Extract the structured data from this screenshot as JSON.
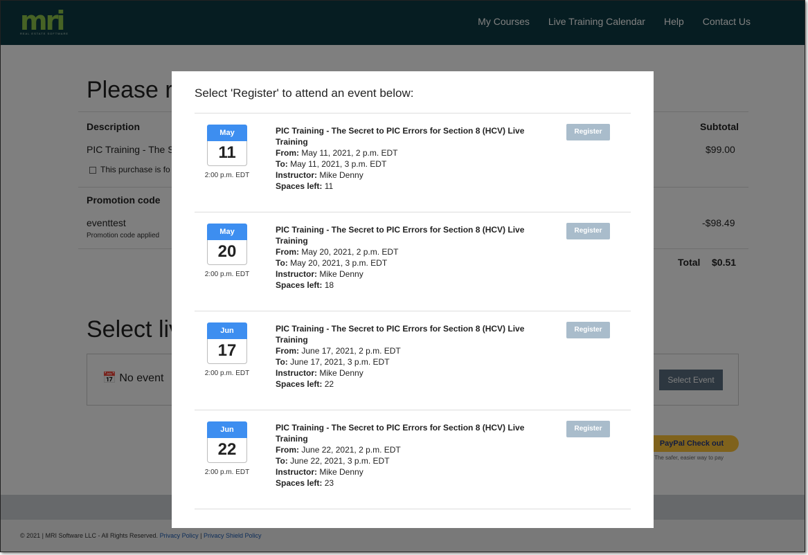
{
  "nav": {
    "logo_text": "mri",
    "logo_subtext": "REAL ESTATE SOFTWARE",
    "links": [
      "My Courses",
      "Live Training Calendar",
      "Help",
      "Contact Us"
    ]
  },
  "background": {
    "heading1": "Please re",
    "description_header": "Description",
    "subtotal_header": "Subtotal",
    "item_name": "PIC Training - The S",
    "item_price": "$99.00",
    "purchase_check_label": "This purchase is fo",
    "promo_header": "Promotion code",
    "promo_code": "eventtest",
    "promo_note": "Promotion code applied",
    "promo_discount": "-$98.49",
    "total_label": "Total",
    "total_value": "$0.51",
    "heading2": "Select liv",
    "no_event_text": "No event",
    "select_event_button": "Select Event",
    "paypal_label": "PayPal Check out",
    "paypal_sub": "The safer, easier way to pay"
  },
  "footer": {
    "copyright": "© 2021 | MRI Software LLC - All Rights Reserved.",
    "privacy_policy": "Privacy Policy",
    "separator": "|",
    "privacy_shield": "Privacy Shield Policy"
  },
  "modal": {
    "title": "Select 'Register' to attend an event below:",
    "register_label": "Register",
    "labels": {
      "from": "From:",
      "to": "To:",
      "instructor": "Instructor:",
      "spaces": "Spaces left:"
    },
    "events": [
      {
        "month": "May",
        "day": "11",
        "time": "2:00 p.m. EDT",
        "title": "PIC Training - The Secret to PIC Errors for Section 8 (HCV) Live Training",
        "from": "May 11, 2021, 2 p.m. EDT",
        "to": "May 11, 2021, 3 p.m. EDT",
        "instructor": "Mike Denny",
        "spaces_left": "11"
      },
      {
        "month": "May",
        "day": "20",
        "time": "2:00 p.m. EDT",
        "title": "PIC Training - The Secret to PIC Errors for Section 8 (HCV) Live Training",
        "from": "May 20, 2021, 2 p.m. EDT",
        "to": "May 20, 2021, 3 p.m. EDT",
        "instructor": "Mike Denny",
        "spaces_left": "18"
      },
      {
        "month": "Jun",
        "day": "17",
        "time": "2:00 p.m. EDT",
        "title": "PIC Training - The Secret to PIC Errors for Section 8 (HCV) Live Training",
        "from": "June 17, 2021, 2 p.m. EDT",
        "to": "June 17, 2021, 3 p.m. EDT",
        "instructor": "Mike Denny",
        "spaces_left": "22"
      },
      {
        "month": "Jun",
        "day": "22",
        "time": "2:00 p.m. EDT",
        "title": "PIC Training - The Secret to PIC Errors for Section 8 (HCV) Live Training",
        "from": "June 22, 2021, 2 p.m. EDT",
        "to": "June 22, 2021, 3 p.m. EDT",
        "instructor": "Mike Denny",
        "spaces_left": "23"
      }
    ]
  },
  "colors": {
    "header_bg": "#0d3b44",
    "calendar_accent": "#3d8ef0",
    "register_button": "#a9bccb"
  }
}
